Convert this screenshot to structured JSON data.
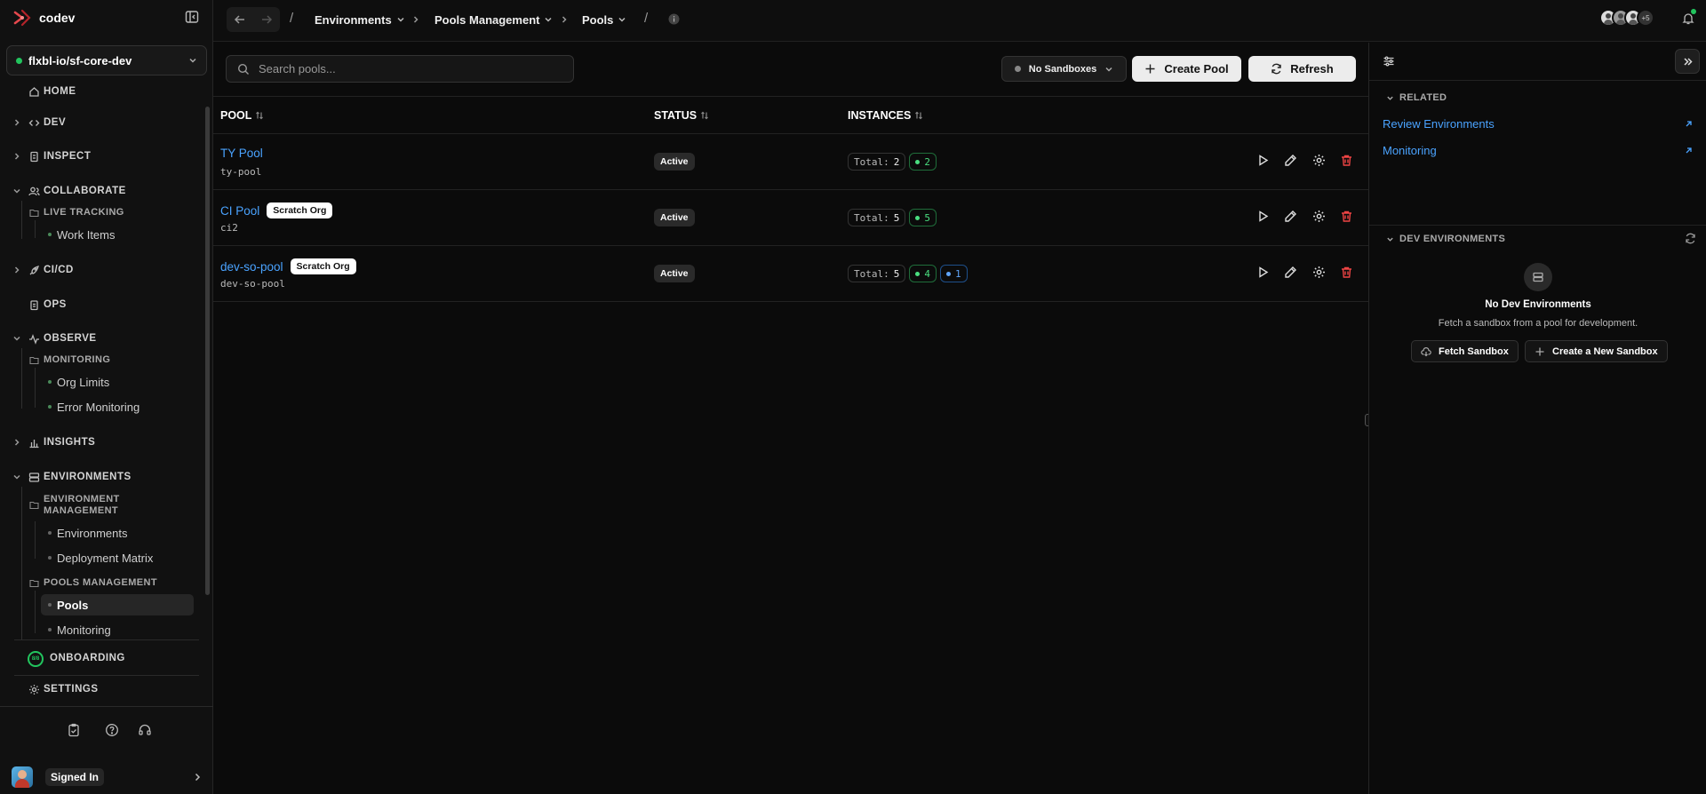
{
  "app": {
    "name": "codev",
    "org": "flxbl-io/sf-core-dev"
  },
  "sidebar": {
    "home": "HOME",
    "dev": "DEV",
    "inspect": "INSPECT",
    "collaborate": "COLLABORATE",
    "live_tracking": "LIVE TRACKING",
    "work_items": "Work Items",
    "cicd": "CI/CD",
    "ops": "OPS",
    "observe": "OBSERVE",
    "monitoring": "MONITORING",
    "org_limits": "Org Limits",
    "error_monitoring": "Error Monitoring",
    "insights": "INSIGHTS",
    "environments": "ENVIRONMENTS",
    "environment_management": "ENVIRONMENT MANAGEMENT",
    "env_environments": "Environments",
    "deployment_matrix": "Deployment Matrix",
    "pools_management": "POOLS MANAGEMENT",
    "pools": "Pools",
    "pools_monitoring": "Monitoring",
    "onboarding": "ONBOARDING",
    "onboarding_progress": "8/8",
    "settings": "SETTINGS",
    "signed_in": "Signed In"
  },
  "topbar": {
    "breadcrumbs": [
      "Environments",
      "Pools Management",
      "Pools"
    ],
    "extra_collaborators": "+5"
  },
  "toolbar": {
    "search_placeholder": "Search pools...",
    "sandbox_filter": "No Sandboxes",
    "create_label": "Create Pool",
    "refresh_label": "Refresh"
  },
  "table": {
    "columns": [
      "POOL",
      "STATUS",
      "INSTANCES"
    ],
    "total_label": "Total:",
    "rows": [
      {
        "name": "TY Pool",
        "tag": "",
        "id": "ty-pool",
        "status": "Active",
        "total": "2",
        "green": "2",
        "blue": ""
      },
      {
        "name": "CI Pool",
        "tag": "Scratch Org",
        "id": "ci2",
        "status": "Active",
        "total": "5",
        "green": "5",
        "blue": ""
      },
      {
        "name": "dev-so-pool",
        "tag": "Scratch Org",
        "id": "dev-so-pool",
        "status": "Active",
        "total": "5",
        "green": "4",
        "blue": "1"
      }
    ]
  },
  "panel": {
    "related_title": "RELATED",
    "related_links": [
      "Review Environments",
      "Monitoring"
    ],
    "dev_env_title": "DEV ENVIRONMENTS",
    "empty_title": "No Dev Environments",
    "empty_sub": "Fetch a sandbox from a pool for development.",
    "fetch_label": "Fetch Sandbox",
    "create_label": "Create a New Sandbox"
  },
  "colors": {
    "accent_link": "#4aa3ff",
    "active_green": "#22c55e",
    "danger": "#ef4444"
  }
}
